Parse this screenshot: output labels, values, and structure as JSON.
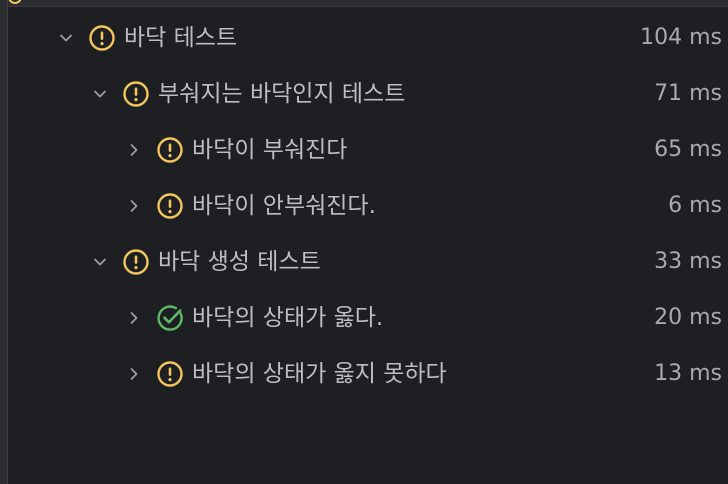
{
  "colors": {
    "background": "#1e1f22",
    "text": "#bcbec4",
    "duration_text": "#a8aab0",
    "warning": "#f2c55c",
    "passed": "#5fb865",
    "chevron": "#9da0a8"
  },
  "tests": [
    {
      "label": "바닥 테스트",
      "duration": "104 ms",
      "status": "warning",
      "expanded": true,
      "icon": "warning-icon"
    },
    {
      "label": "부숴지는 바닥인지 테스트",
      "duration": "71 ms",
      "status": "warning",
      "expanded": true,
      "icon": "warning-icon"
    },
    {
      "label": "바닥이 부숴진다",
      "duration": "65 ms",
      "status": "warning",
      "expanded": false,
      "icon": "warning-icon"
    },
    {
      "label": "바닥이 안부숴진다.",
      "duration": "6 ms",
      "status": "warning",
      "expanded": false,
      "icon": "warning-icon"
    },
    {
      "label": "바닥 생성 테스트",
      "duration": "33 ms",
      "status": "warning",
      "expanded": true,
      "icon": "warning-icon"
    },
    {
      "label": "바닥의 상태가 옳다.",
      "duration": "20 ms",
      "status": "passed",
      "expanded": false,
      "icon": "check-circle-icon"
    },
    {
      "label": "바닥의 상태가 옳지 못하다",
      "duration": "13 ms",
      "status": "warning",
      "expanded": false,
      "icon": "warning-icon"
    }
  ]
}
